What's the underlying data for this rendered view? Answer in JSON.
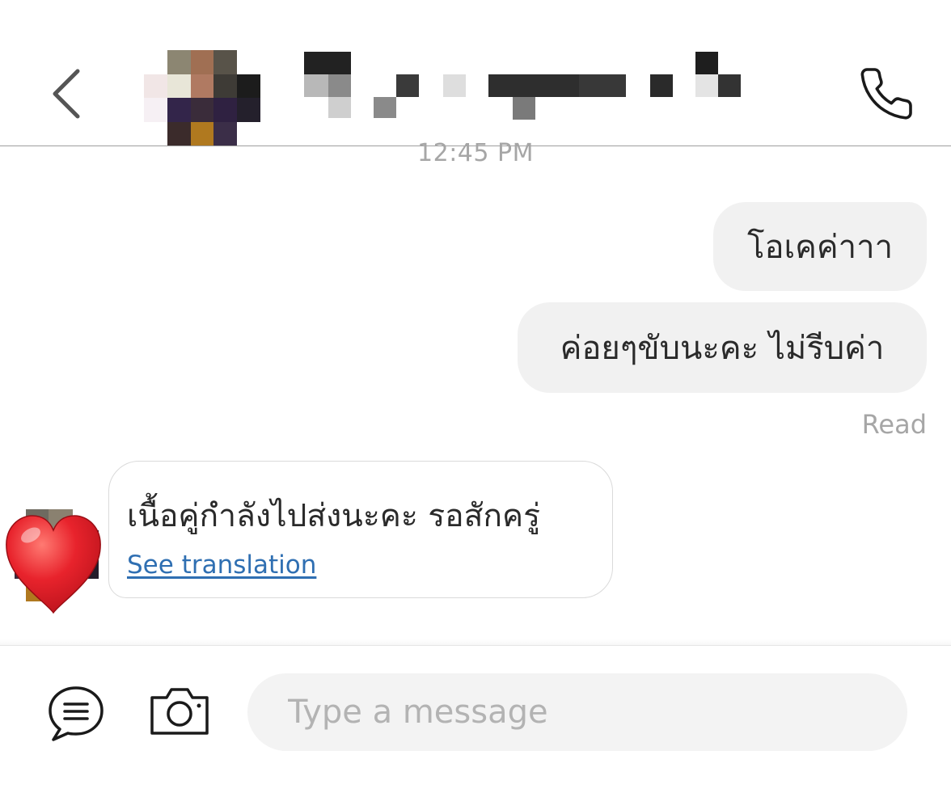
{
  "header": {
    "contact_name": "",
    "back_icon": "chevron-left-icon",
    "call_icon": "phone-icon"
  },
  "chat": {
    "timestamp": "12:45 PM",
    "outgoing": [
      {
        "text": "โอเคค่าาา"
      },
      {
        "text": "ค่อยๆขับนะคะ ไม่รีบค่า"
      }
    ],
    "read_status": "Read",
    "incoming": [
      {
        "text": "เนื้อคู่กำลังไปส่งนะคะ รอสักครู่",
        "translate_link": "See translation",
        "reaction": "heart"
      }
    ]
  },
  "input_bar": {
    "placeholder": "Type a message",
    "menu_icon": "chat-menu-icon",
    "camera_icon": "camera-icon"
  },
  "colors": {
    "outgoing_bubble": "#f1f1f1",
    "incoming_bubble_border": "#dadada",
    "link": "#2f6fb2",
    "muted_text": "#a6a6a6",
    "input_background": "#f3f3f3",
    "heart": "#e0202a"
  }
}
